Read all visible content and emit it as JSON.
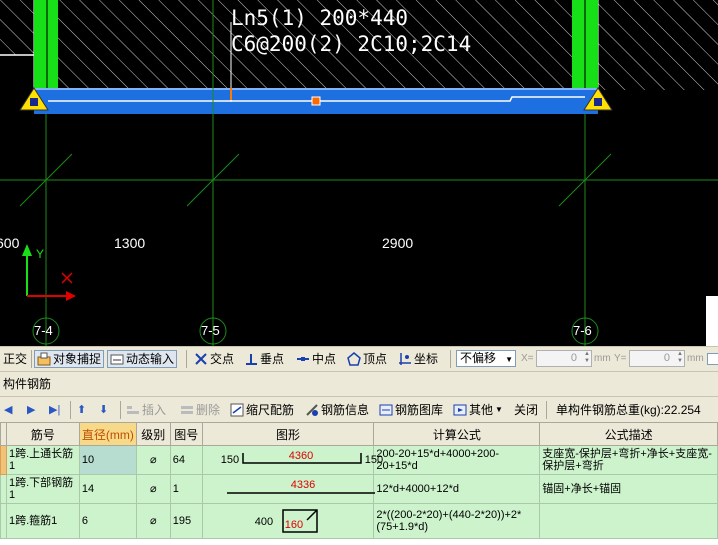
{
  "canvas": {
    "beam_label_line1": "Ln5(1) 200*440",
    "beam_label_line2": "C6@200(2) 2C10;2C14",
    "dim_left": "600",
    "dim_mid": "1300",
    "dim_right": "2900",
    "axes": [
      "7-4",
      "7-5",
      "7-6"
    ],
    "ucs_y": "Y",
    "ucs_x": "X"
  },
  "snap_toolbar": {
    "ortho": "正交",
    "object_snap": "对象捕捉",
    "dynamic_input": "动态输入",
    "intersection": "交点",
    "perpendicular": "垂点",
    "midpoint": "中点",
    "vertex": "顶点",
    "coordinate": "坐标",
    "offset_value": "不偏移",
    "x_label": "X=",
    "x_value": "0",
    "y_label": "Y=",
    "y_value": "0",
    "unit": "mm"
  },
  "panel": {
    "title": "构件钢筋"
  },
  "rebar_toolbar": {
    "insert": "插入",
    "delete": "删除",
    "scale_rebar": "缩尺配筋",
    "rebar_info": "钢筋信息",
    "rebar_library": "钢筋图库",
    "other": "其他",
    "close": "关闭",
    "total_weight_label": "单构件钢筋总重(kg):",
    "total_weight_value": "22.254"
  },
  "table": {
    "headers": [
      "筋号",
      "直径(mm)",
      "级别",
      "图号",
      "图形",
      "计算公式",
      "公式描述"
    ],
    "rows": [
      {
        "name": "1跨.上通长筋1",
        "diameter": "10",
        "grade": "⌀",
        "figure_no": "64",
        "shape_left": "150",
        "shape_mid": "4360",
        "shape_right": "150",
        "formula": "200-20+15*d+4000+200-20+15*d",
        "description": "支座宽-保护层+弯折+净长+支座宽-保护层+弯折"
      },
      {
        "name": "1跨.下部钢筋1",
        "diameter": "14",
        "grade": "⌀",
        "figure_no": "1",
        "shape_mid": "4336",
        "formula": "12*d+4000+12*d",
        "description": "锚固+净长+锚固"
      },
      {
        "name": "1跨.箍筋1",
        "diameter": "6",
        "grade": "⌀",
        "figure_no": "195",
        "shape_left": "400",
        "shape_mid": "160",
        "formula": "2*((200-2*20)+(440-2*20))+2*(75+1.9*d)",
        "description": ""
      }
    ]
  },
  "colors": {
    "beam_blue": "#1e6fe0",
    "support_green": "#18e018",
    "grid_line_green": "#1c8c1c",
    "row_green": "#cdf3cd",
    "dim_red": "#e00000"
  }
}
